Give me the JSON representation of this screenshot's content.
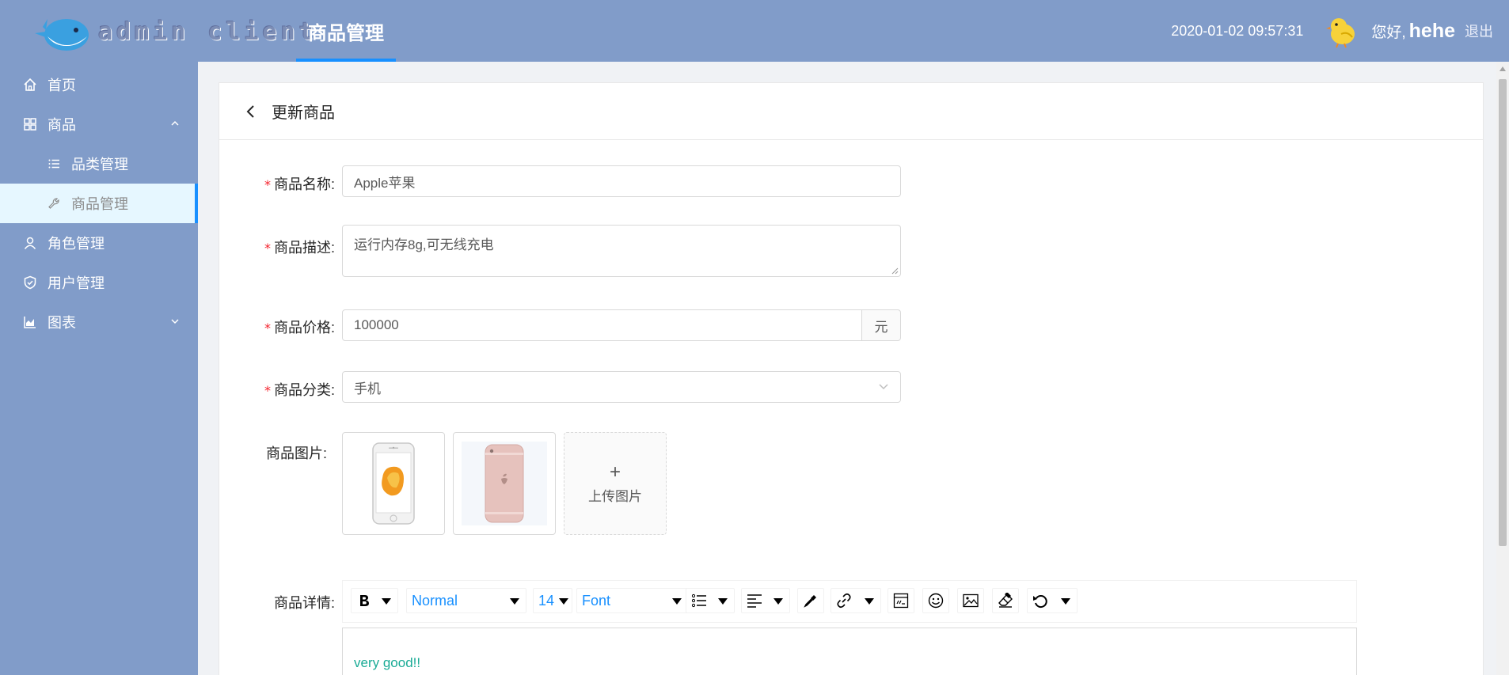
{
  "header": {
    "logo_text": "admin client",
    "active_tab": "商品管理",
    "datetime": "2020-01-02 09:57:31",
    "greeting": "您好,",
    "username": "hehe",
    "logout": "退出"
  },
  "sidebar": {
    "items": [
      {
        "label": "首页",
        "icon": "home-icon"
      },
      {
        "label": "商品",
        "icon": "appstore-icon",
        "expanded": true
      },
      {
        "label": "品类管理",
        "icon": "bars-icon"
      },
      {
        "label": "商品管理",
        "icon": "tool-icon",
        "active": true
      },
      {
        "label": "角色管理",
        "icon": "user-icon"
      },
      {
        "label": "用户管理",
        "icon": "safety-icon"
      },
      {
        "label": "图表",
        "icon": "area-chart-icon",
        "expanded": false
      }
    ]
  },
  "page": {
    "title": "更新商品"
  },
  "form": {
    "required_mark": "*",
    "name": {
      "label": "商品名称:",
      "value": "Apple苹果"
    },
    "desc": {
      "label": "商品描述:",
      "value": "运行内存8g,可无线充电"
    },
    "price": {
      "label": "商品价格:",
      "value": "100000",
      "addon": "元"
    },
    "category": {
      "label": "商品分类:",
      "value": "手机"
    },
    "images": {
      "label": "商品图片:",
      "upload_plus": "+",
      "upload_text": "上传图片",
      "pictures": [
        "iphone-7-front",
        "iphone-6s-rose-back"
      ]
    },
    "detail": {
      "label": "商品详情:",
      "toolbar": {
        "block_type": "Normal",
        "font_size": "14",
        "font_family": "Font"
      },
      "content": "very good!!"
    }
  },
  "colors": {
    "header_bg": "#819cc9",
    "accent": "#1890ff",
    "active_item_bg": "#e6f7ff",
    "required": "#f5222d",
    "editor_text": "#1bab96"
  }
}
